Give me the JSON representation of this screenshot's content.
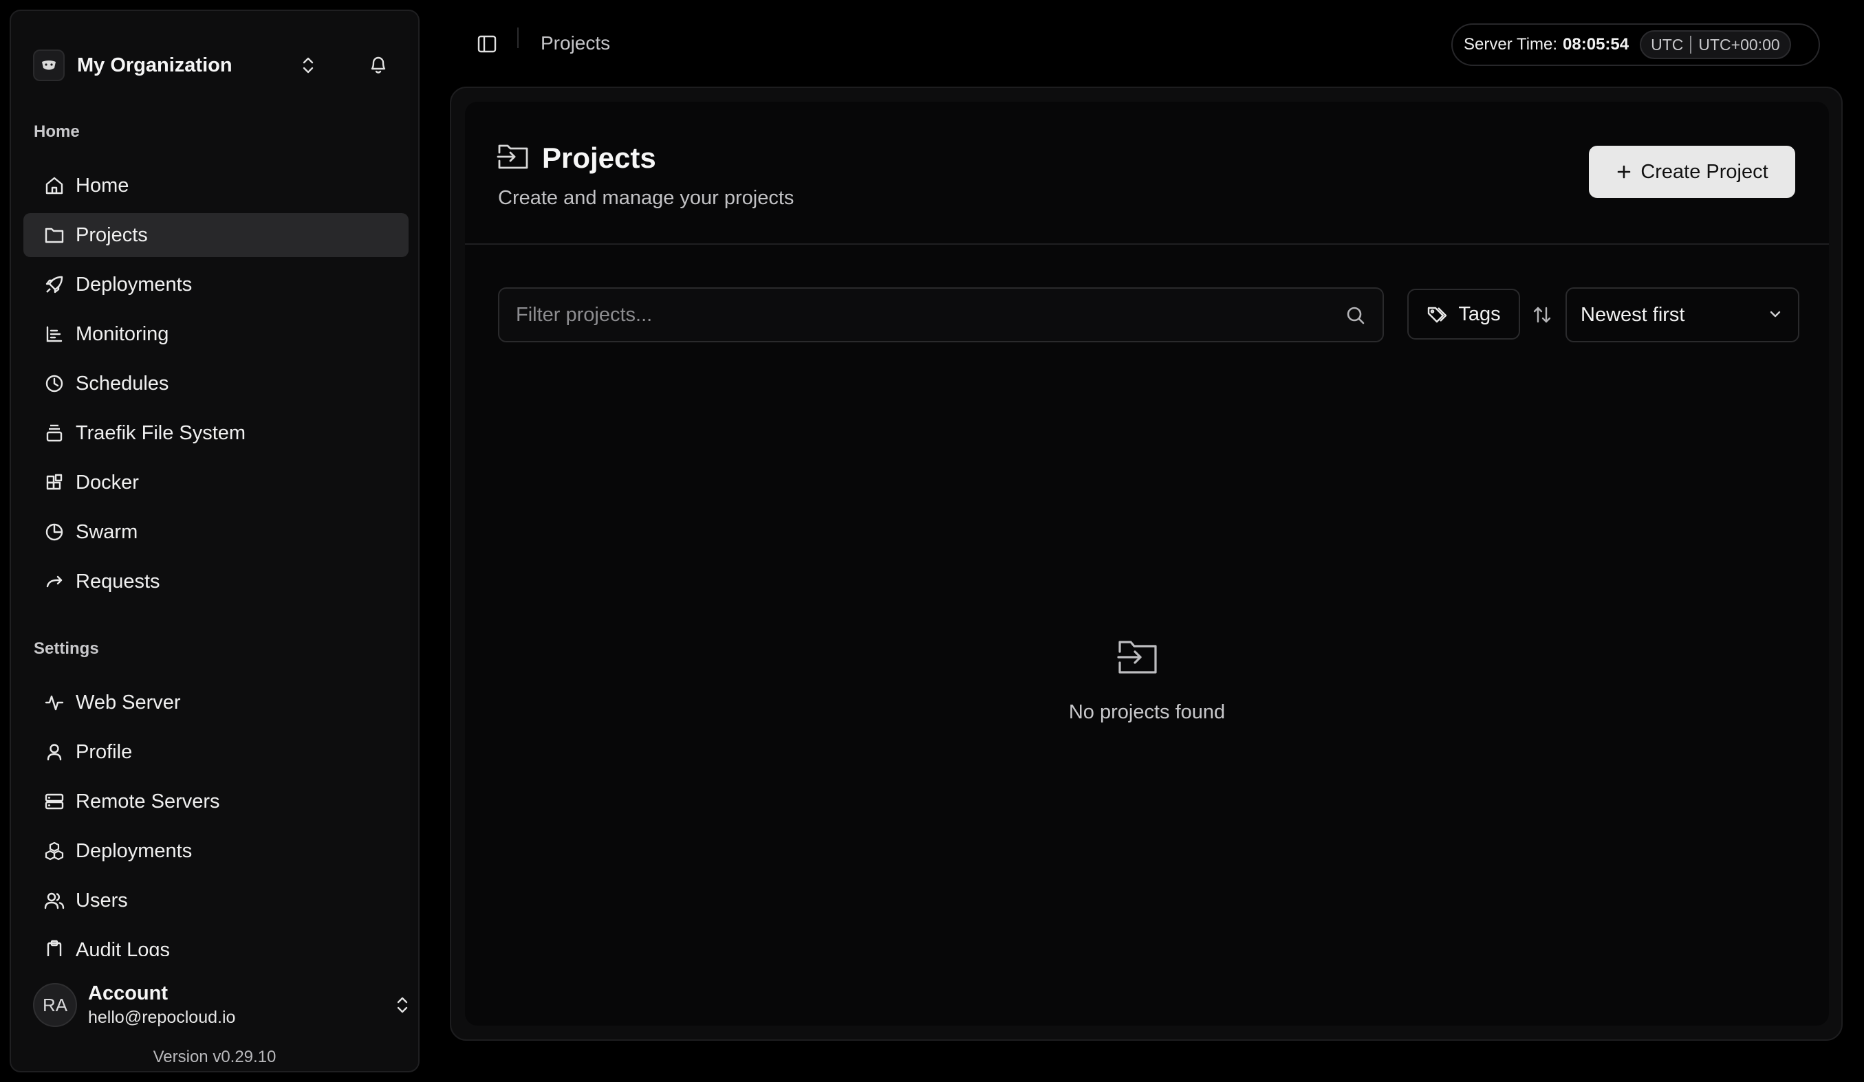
{
  "sidebar": {
    "org": {
      "name": "My Organization",
      "logo_icon": "org-logo-icon"
    },
    "home_section_label": "Home",
    "home_items": [
      {
        "label": "Home",
        "icon": "home-icon"
      },
      {
        "label": "Projects",
        "icon": "folder-icon",
        "active": true
      },
      {
        "label": "Deployments",
        "icon": "rocket-icon"
      },
      {
        "label": "Monitoring",
        "icon": "chart-icon"
      },
      {
        "label": "Schedules",
        "icon": "clock-icon"
      },
      {
        "label": "Traefik File System",
        "icon": "layers-icon"
      },
      {
        "label": "Docker",
        "icon": "blocks-icon"
      },
      {
        "label": "Swarm",
        "icon": "pie-icon"
      },
      {
        "label": "Requests",
        "icon": "forward-icon"
      }
    ],
    "settings_section_label": "Settings",
    "settings_items": [
      {
        "label": "Web Server",
        "icon": "activity-icon"
      },
      {
        "label": "Profile",
        "icon": "user-icon"
      },
      {
        "label": "Remote Servers",
        "icon": "server-icon"
      },
      {
        "label": "Deployments",
        "icon": "boxes-icon"
      },
      {
        "label": "Users",
        "icon": "users-icon"
      },
      {
        "label": "Audit Logs",
        "icon": "clipboard-icon"
      }
    ],
    "account": {
      "initials": "RA",
      "name": "Account",
      "email": "hello@repocloud.io"
    },
    "version": "Version v0.29.10"
  },
  "topbar": {
    "breadcrumb": "Projects",
    "server_time_label": "Server Time:",
    "server_time_value": "08:05:54",
    "tz_short": "UTC",
    "tz_offset": "UTC+00:00"
  },
  "main": {
    "title": "Projects",
    "subtitle": "Create and manage your projects",
    "create_button": "Create Project",
    "filter_placeholder": "Filter projects...",
    "tags_button": "Tags",
    "sort_value": "Newest first",
    "empty_text": "No projects found"
  },
  "colors": {
    "background": "#000000",
    "sidebar_bg": "#0d0d0e",
    "active_item_bg": "#28282a",
    "primary_button_bg": "#e8e8e8"
  }
}
